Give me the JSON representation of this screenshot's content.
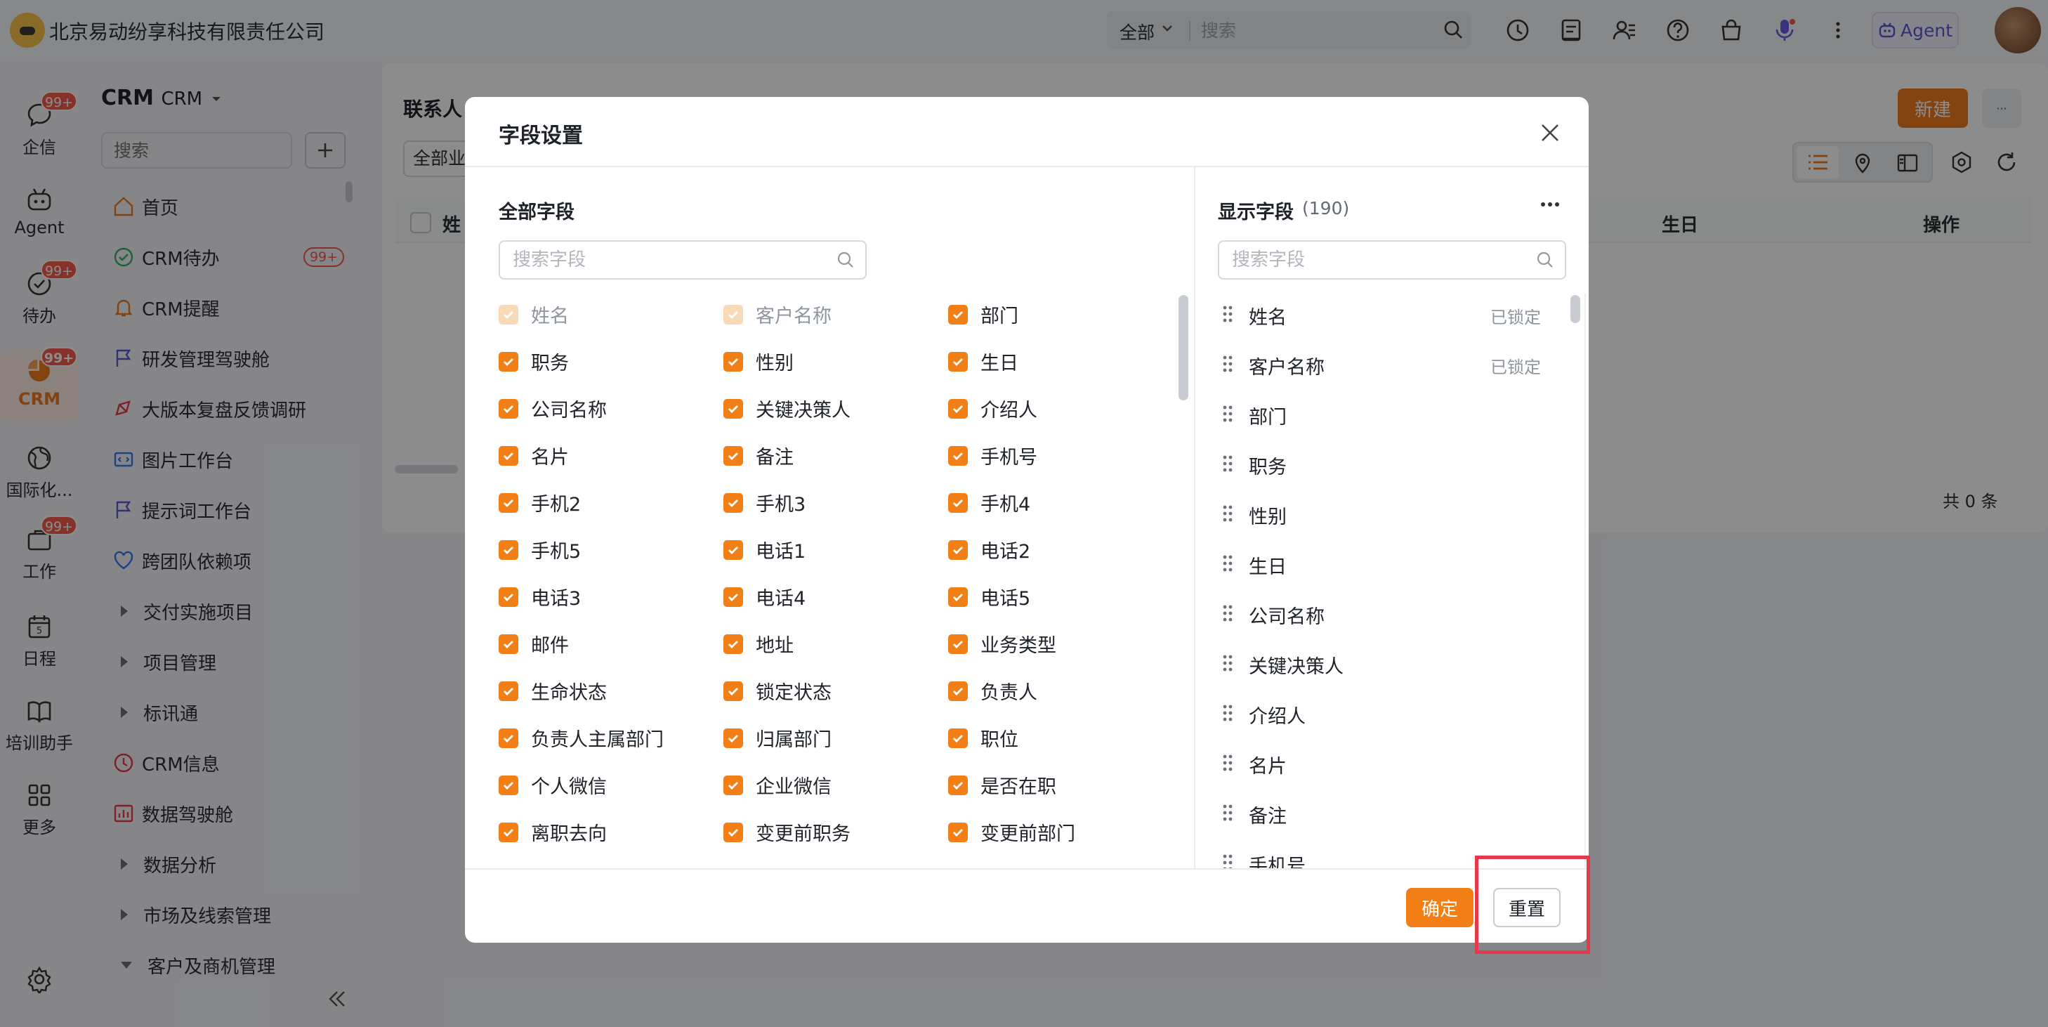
{
  "app": {
    "company": "北京易动纷享科技有限责任公司"
  },
  "topbar": {
    "scope": "全部",
    "search_placeholder": "搜索",
    "agent_label": "Agent"
  },
  "rail": [
    {
      "label": "企信",
      "badge": "99+"
    },
    {
      "label": "Agent",
      "badge": ""
    },
    {
      "label": "待办",
      "badge": "99+"
    },
    {
      "label": "CRM",
      "badge": "99+"
    },
    {
      "label": "国际化...",
      "badge": ""
    },
    {
      "label": "工作",
      "badge": "99+"
    },
    {
      "label": "日程",
      "badge": ""
    },
    {
      "label": "培训助手",
      "badge": ""
    },
    {
      "label": "更多",
      "badge": ""
    }
  ],
  "sidebar": {
    "title": "CRM",
    "subtitle": "CRM",
    "search_placeholder": "搜索",
    "items": [
      {
        "label": "首页"
      },
      {
        "label": "CRM待办",
        "badge": "99+"
      },
      {
        "label": "CRM提醒"
      },
      {
        "label": "研发管理驾驶舱"
      },
      {
        "label": "大版本复盘反馈调研"
      },
      {
        "label": "图片工作台"
      },
      {
        "label": "提示词工作台"
      },
      {
        "label": "跨团队依赖项"
      },
      {
        "label": "交付实施项目"
      },
      {
        "label": "项目管理"
      },
      {
        "label": "标讯通"
      },
      {
        "label": "CRM信息"
      },
      {
        "label": "数据驾驶舱"
      },
      {
        "label": "数据分析"
      },
      {
        "label": "市场及线索管理"
      },
      {
        "label": "客户及商机管理"
      }
    ]
  },
  "main": {
    "title": "联系人",
    "filter": "全部业",
    "new_label": "新建",
    "more_label": "···",
    "col_first": "姓",
    "col_birthday": "生日",
    "col_ops": "操作",
    "total": "共 0 条"
  },
  "modal": {
    "title": "字段设置",
    "left_heading": "全部字段",
    "left_search_placeholder": "搜索字段",
    "right_heading": "显示字段",
    "right_count": "(190)",
    "right_search_placeholder": "搜索字段",
    "ok_label": "确定",
    "reset_label": "重置",
    "fields": [
      {
        "label": "姓名",
        "checked": true,
        "disabled": true
      },
      {
        "label": "客户名称",
        "checked": true,
        "disabled": true
      },
      {
        "label": "部门",
        "checked": true
      },
      {
        "label": "职务",
        "checked": true
      },
      {
        "label": "性别",
        "checked": true
      },
      {
        "label": "生日",
        "checked": true
      },
      {
        "label": "公司名称",
        "checked": true
      },
      {
        "label": "关键决策人",
        "checked": true
      },
      {
        "label": "介绍人",
        "checked": true
      },
      {
        "label": "名片",
        "checked": true
      },
      {
        "label": "备注",
        "checked": true
      },
      {
        "label": "手机号",
        "checked": true
      },
      {
        "label": "手机2",
        "checked": true
      },
      {
        "label": "手机3",
        "checked": true
      },
      {
        "label": "手机4",
        "checked": true
      },
      {
        "label": "手机5",
        "checked": true
      },
      {
        "label": "电话1",
        "checked": true
      },
      {
        "label": "电话2",
        "checked": true
      },
      {
        "label": "电话3",
        "checked": true
      },
      {
        "label": "电话4",
        "checked": true
      },
      {
        "label": "电话5",
        "checked": true
      },
      {
        "label": "邮件",
        "checked": true
      },
      {
        "label": "地址",
        "checked": true
      },
      {
        "label": "业务类型",
        "checked": true
      },
      {
        "label": "生命状态",
        "checked": true
      },
      {
        "label": "锁定状态",
        "checked": true
      },
      {
        "label": "负责人",
        "checked": true
      },
      {
        "label": "负责人主属部门",
        "checked": true
      },
      {
        "label": "归属部门",
        "checked": true
      },
      {
        "label": "职位",
        "checked": true
      },
      {
        "label": "个人微信",
        "checked": true
      },
      {
        "label": "企业微信",
        "checked": true
      },
      {
        "label": "是否在职",
        "checked": true
      },
      {
        "label": "离职去向",
        "checked": true
      },
      {
        "label": "变更前职务",
        "checked": true
      },
      {
        "label": "变更前部门",
        "checked": true
      }
    ],
    "shown_fields": [
      {
        "label": "姓名",
        "tag": "已锁定"
      },
      {
        "label": "客户名称",
        "tag": "已锁定"
      },
      {
        "label": "部门",
        "tag": ""
      },
      {
        "label": "职务",
        "tag": ""
      },
      {
        "label": "性别",
        "tag": ""
      },
      {
        "label": "生日",
        "tag": ""
      },
      {
        "label": "公司名称",
        "tag": ""
      },
      {
        "label": "关键决策人",
        "tag": ""
      },
      {
        "label": "介绍人",
        "tag": ""
      },
      {
        "label": "名片",
        "tag": ""
      },
      {
        "label": "备注",
        "tag": ""
      },
      {
        "label": "手机号",
        "tag": ""
      }
    ]
  },
  "colors": {
    "accent": "#f27f16",
    "highlight": "#e8394a",
    "badge": "#f55a4e"
  }
}
